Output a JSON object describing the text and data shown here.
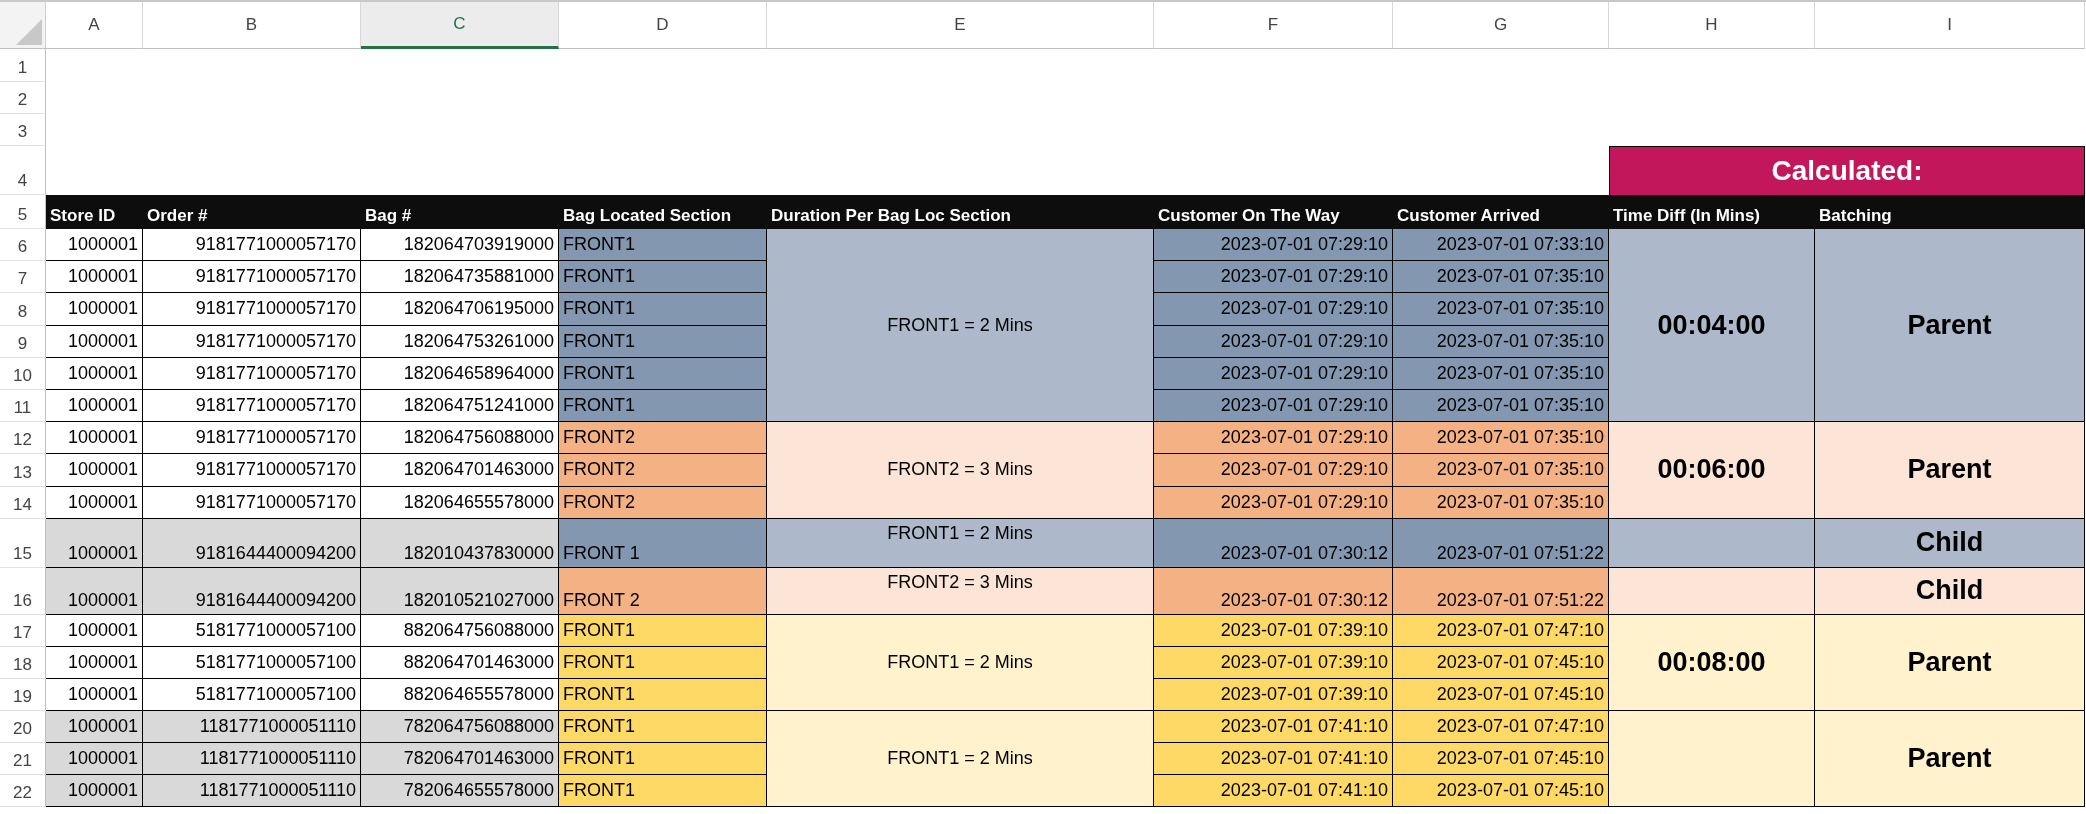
{
  "column_headers": [
    {
      "label": "A",
      "selected": false
    },
    {
      "label": "B",
      "selected": false
    },
    {
      "label": "C",
      "selected": true
    },
    {
      "label": "D",
      "selected": false
    },
    {
      "label": "E",
      "selected": false
    },
    {
      "label": "F",
      "selected": false
    },
    {
      "label": "G",
      "selected": false
    },
    {
      "label": "H",
      "selected": false
    },
    {
      "label": "I",
      "selected": false
    }
  ],
  "row_numbers": [
    "1",
    "2",
    "3",
    "4",
    "5",
    "6",
    "7",
    "8",
    "9",
    "10",
    "11",
    "12",
    "13",
    "14",
    "15",
    "16",
    "17",
    "18",
    "19",
    "20",
    "21",
    "22"
  ],
  "calculated_banner": "Calculated:",
  "table_headers": [
    "Store ID",
    "Order #",
    "Bag #",
    "Bag Located Section",
    "Duration Per Bag Loc Section",
    "Customer On The Way",
    "Customer Arrived",
    "Time Diff (In Mins)",
    "Batching"
  ],
  "groups": [
    {
      "color": "#8497b0",
      "duration": "FRONT1 = 2 Mins",
      "time_diff": "00:04:00",
      "batching": "Parent",
      "rows": [
        {
          "store_id": "1000001",
          "order": "9181771000057170",
          "bag": "182064703919000",
          "section": "FRONT1",
          "on_the_way": "2023-07-01 07:29:10",
          "arrived": "2023-07-01 07:33:10",
          "shaded": false
        },
        {
          "store_id": "1000001",
          "order": "9181771000057170",
          "bag": "182064735881000",
          "section": "FRONT1",
          "on_the_way": "2023-07-01 07:29:10",
          "arrived": "2023-07-01 07:35:10",
          "shaded": false
        },
        {
          "store_id": "1000001",
          "order": "9181771000057170",
          "bag": "182064706195000",
          "section": "FRONT1",
          "on_the_way": "2023-07-01 07:29:10",
          "arrived": "2023-07-01 07:35:10",
          "shaded": false
        },
        {
          "store_id": "1000001",
          "order": "9181771000057170",
          "bag": "182064753261000",
          "section": "FRONT1",
          "on_the_way": "2023-07-01 07:29:10",
          "arrived": "2023-07-01 07:35:10",
          "shaded": false
        },
        {
          "store_id": "1000001",
          "order": "9181771000057170",
          "bag": "182064658964000",
          "section": "FRONT1",
          "on_the_way": "2023-07-01 07:29:10",
          "arrived": "2023-07-01 07:35:10",
          "shaded": false
        },
        {
          "store_id": "1000001",
          "order": "9181771000057170",
          "bag": "182064751241000",
          "section": "FRONT1",
          "on_the_way": "2023-07-01 07:29:10",
          "arrived": "2023-07-01 07:35:10",
          "shaded": false
        }
      ]
    },
    {
      "color": "#f4b183",
      "duration": "FRONT2 = 3 Mins",
      "time_diff": "00:06:00",
      "batching": "Parent",
      "rows": [
        {
          "store_id": "1000001",
          "order": "9181771000057170",
          "bag": "182064756088000",
          "section": "FRONT2",
          "on_the_way": "2023-07-01 07:29:10",
          "arrived": "2023-07-01 07:35:10",
          "shaded": false
        },
        {
          "store_id": "1000001",
          "order": "9181771000057170",
          "bag": "182064701463000",
          "section": "FRONT2",
          "on_the_way": "2023-07-01 07:29:10",
          "arrived": "2023-07-01 07:35:10",
          "shaded": false
        },
        {
          "store_id": "1000001",
          "order": "9181771000057170",
          "bag": "182064655578000",
          "section": "FRONT2",
          "on_the_way": "2023-07-01 07:29:10",
          "arrived": "2023-07-01 07:35:10",
          "shaded": false
        }
      ]
    },
    {
      "color": "#8497b0",
      "duration": "FRONT1 = 2 Mins",
      "batching": "Child",
      "rows": [
        {
          "store_id": "1000001",
          "order": "9181644400094200",
          "bag": "182010437830000",
          "section": "FRONT 1",
          "on_the_way": "2023-07-01 07:30:12",
          "arrived": "2023-07-01 07:51:22",
          "shaded": true
        }
      ]
    },
    {
      "color": "#f4b183",
      "duration": "FRONT2 = 3 Mins",
      "batching": "Child",
      "rows": [
        {
          "store_id": "1000001",
          "order": "9181644400094200",
          "bag": "182010521027000",
          "section": "FRONT 2",
          "on_the_way": "2023-07-01 07:30:12",
          "arrived": "2023-07-01 07:51:22",
          "shaded": true
        }
      ]
    },
    {
      "color": "#ffd966",
      "duration": "FRONT1 = 2 Mins",
      "time_diff": "00:08:00",
      "batching": "Parent",
      "rows": [
        {
          "store_id": "1000001",
          "order": "5181771000057100",
          "bag": "882064756088000",
          "section": "FRONT1",
          "on_the_way": "2023-07-01 07:39:10",
          "arrived": "2023-07-01 07:47:10",
          "shaded": false
        },
        {
          "store_id": "1000001",
          "order": "5181771000057100",
          "bag": "882064701463000",
          "section": "FRONT1",
          "on_the_way": "2023-07-01 07:39:10",
          "arrived": "2023-07-01 07:45:10",
          "shaded": false
        },
        {
          "store_id": "1000001",
          "order": "5181771000057100",
          "bag": "882064655578000",
          "section": "FRONT1",
          "on_the_way": "2023-07-01 07:39:10",
          "arrived": "2023-07-01 07:45:10",
          "shaded": false
        }
      ]
    },
    {
      "color": "#ffd966",
      "duration": "FRONT1 = 2 Mins",
      "batching": "Parent",
      "rows": [
        {
          "store_id": "1000001",
          "order": "1181771000051110",
          "bag": "782064756088000",
          "section": "FRONT1",
          "on_the_way": "2023-07-01 07:41:10",
          "arrived": "2023-07-01 07:47:10",
          "shaded": true
        },
        {
          "store_id": "1000001",
          "order": "1181771000051110",
          "bag": "782064701463000",
          "section": "FRONT1",
          "on_the_way": "2023-07-01 07:41:10",
          "arrived": "2023-07-01 07:45:10",
          "shaded": true
        },
        {
          "store_id": "1000001",
          "order": "1181771000051110",
          "bag": "782064655578000",
          "section": "FRONT1",
          "on_the_way": "2023-07-01 07:41:10",
          "arrived": "2023-07-01 07:45:10",
          "shaded": true
        }
      ]
    }
  ]
}
